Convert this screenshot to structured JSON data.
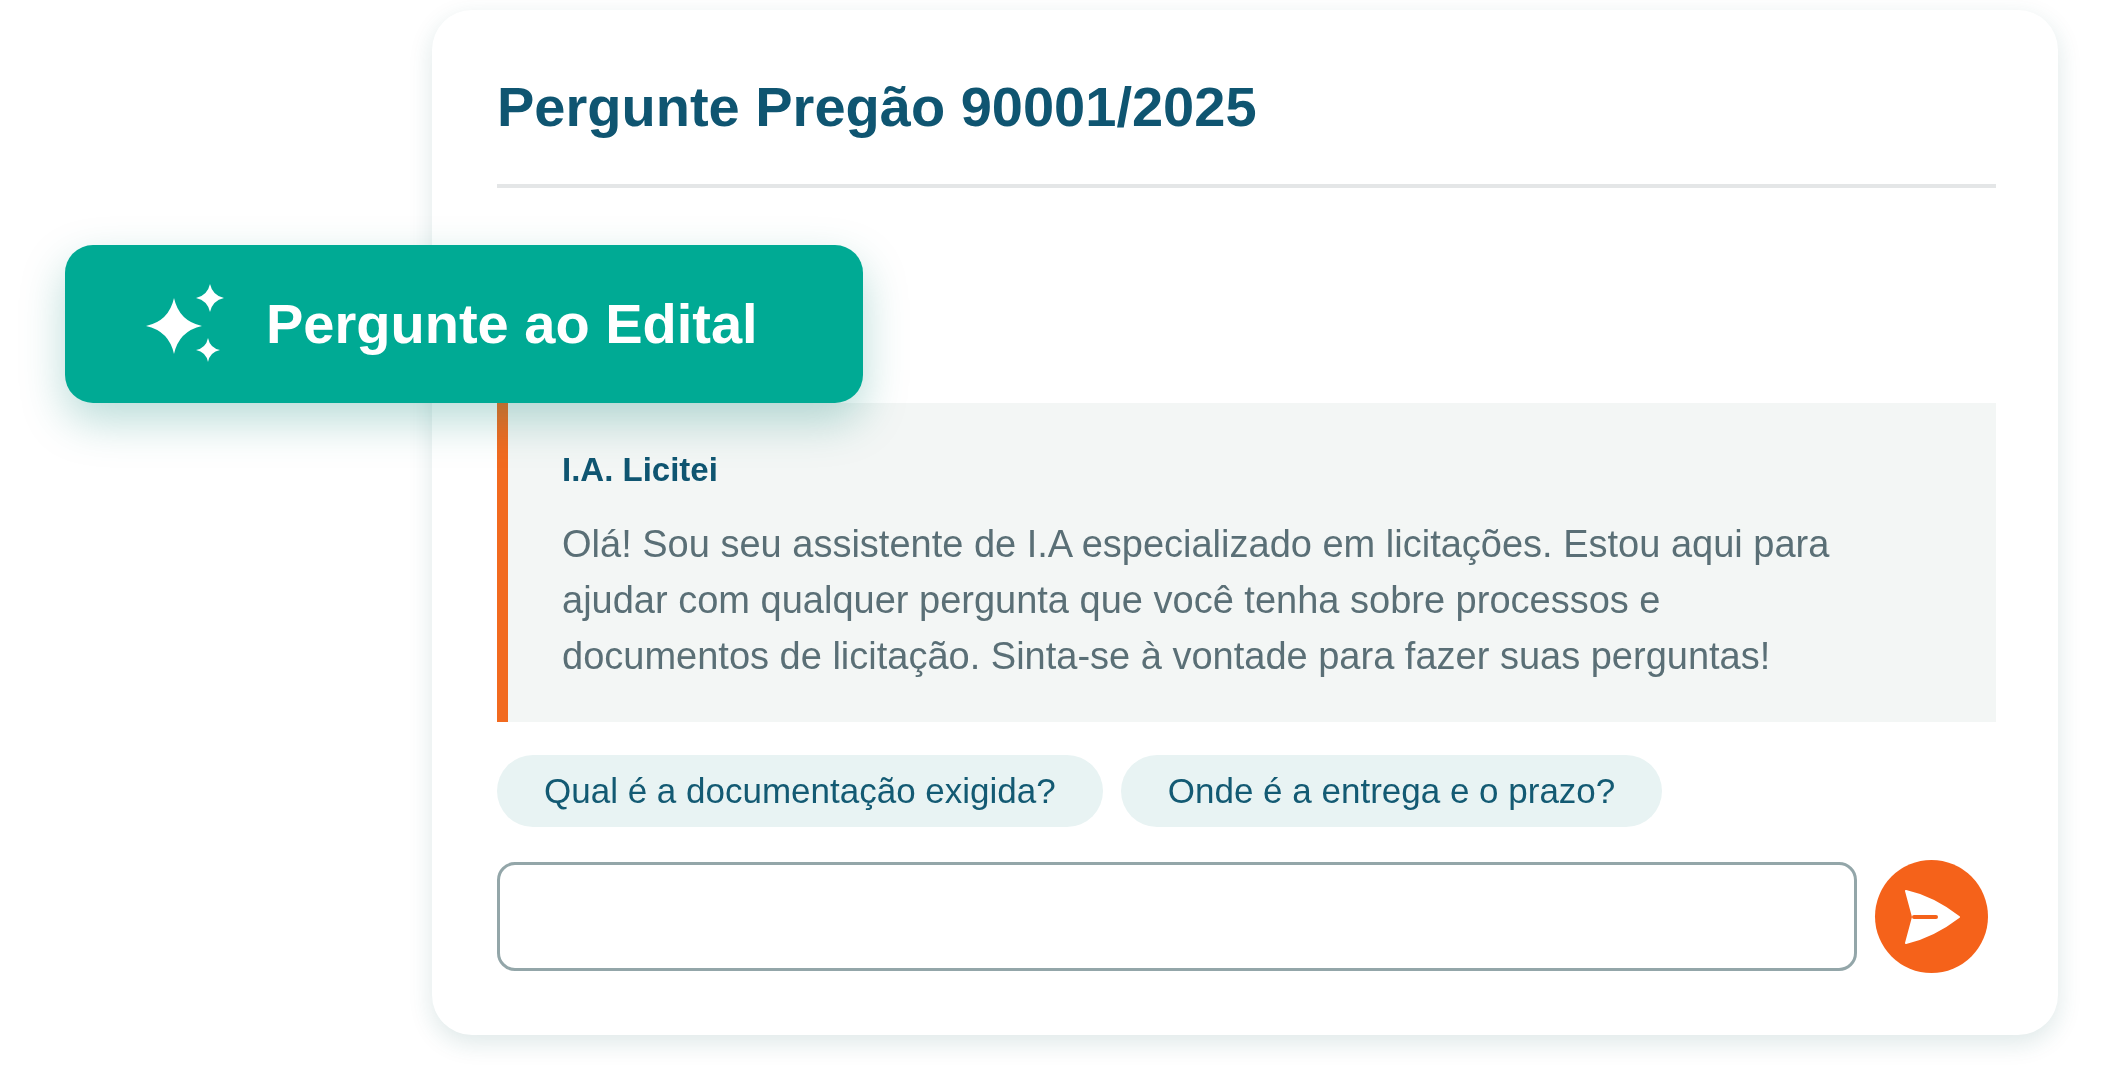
{
  "card": {
    "title": "Pergunte Pregão 90001/2025"
  },
  "badge": {
    "label": "Pergunte ao Edital"
  },
  "message": {
    "sender": "I.A. Licitei",
    "text": "Olá! Sou seu assistente de I.A especializado em licitações. Estou aqui para ajudar com qualquer pergunta que você tenha sobre processos e documentos de licitação. Sinta-se à vontade para fazer suas perguntas!"
  },
  "suggestions": [
    {
      "label": "Qual é a documentação exigida?"
    },
    {
      "label": "Onde é a entrega e o prazo?"
    }
  ]
}
